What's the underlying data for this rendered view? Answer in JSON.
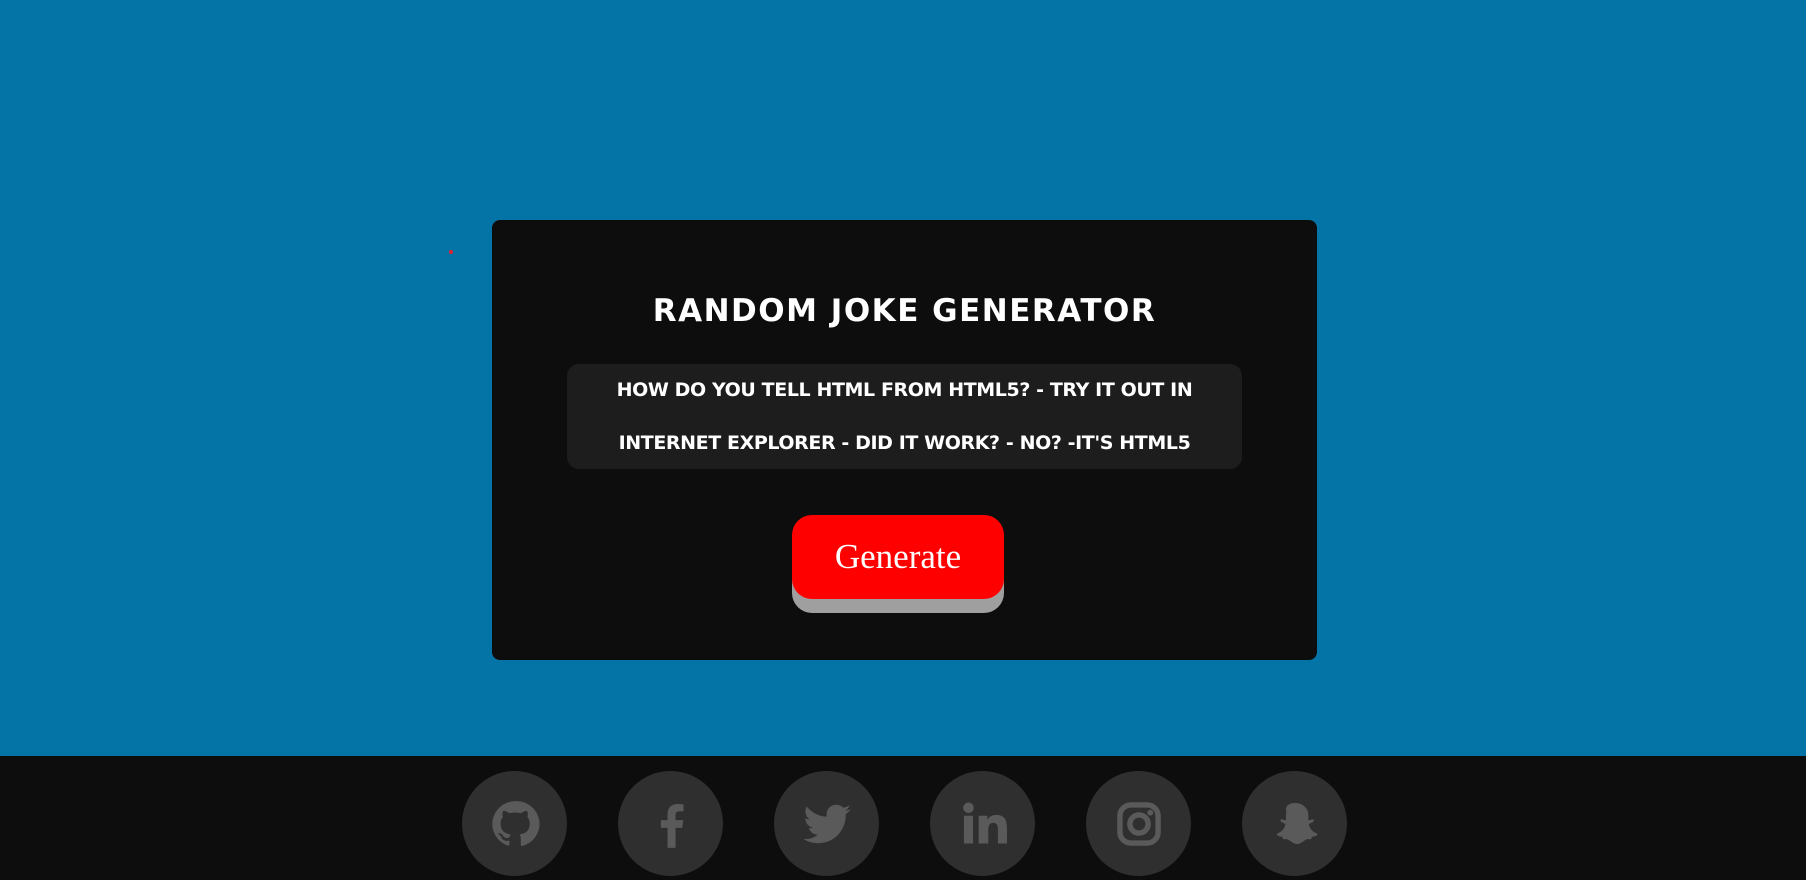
{
  "app": {
    "title": "Random Joke Generator"
  },
  "joke": {
    "text": "How do you tell HTML from HTML5? - Try it out in Internet Explorer - Did it work? - No? -It's HTML5"
  },
  "actions": {
    "generate_label": "Generate"
  },
  "footer": {
    "social_links": [
      {
        "icon": "github-icon"
      },
      {
        "icon": "facebook-icon"
      },
      {
        "icon": "twitter-icon"
      },
      {
        "icon": "linkedin-icon"
      },
      {
        "icon": "instagram-icon"
      },
      {
        "icon": "snapchat-icon"
      }
    ]
  },
  "colors": {
    "page_background": "#0474a7",
    "card_background": "#0d0d0d",
    "joke_background": "#1d1d1d",
    "accent": "#ff0000",
    "button_shadow": "#9f9f9f",
    "footer_background": "#0d0d0d",
    "social_circle": "#2f2f2f",
    "social_icon": "#5a5a5a",
    "red_dot": "#e0242d"
  }
}
